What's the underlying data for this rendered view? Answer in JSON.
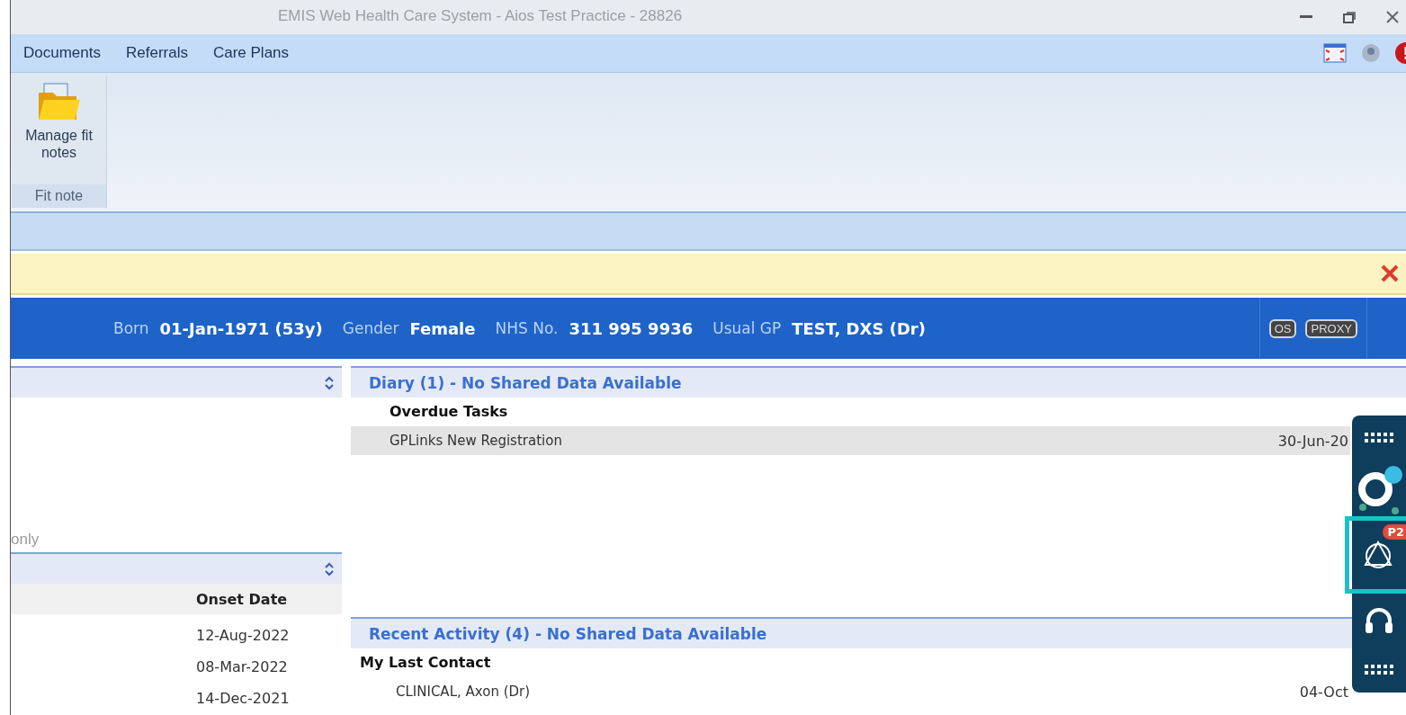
{
  "window": {
    "title": "EMIS Web Health Care System - Aios Test Practice - 28826"
  },
  "menu": [
    {
      "label": "Documents"
    },
    {
      "label": "Referrals"
    },
    {
      "label": "Care Plans"
    }
  ],
  "ribbon": {
    "groups": [
      {
        "label": "Fit note",
        "buttons": [
          {
            "label": "Manage fit notes"
          }
        ]
      }
    ]
  },
  "patient_banner": {
    "fields": [
      {
        "label": "Born",
        "value": "01-Jan-1971 (53y)"
      },
      {
        "label": "Gender",
        "value": "Female"
      },
      {
        "label": "NHS No.",
        "value": "311 995 9936"
      },
      {
        "label": "Usual GP",
        "value": "TEST, DXS (Dr)"
      }
    ],
    "badges": [
      "OS",
      "PROXY"
    ]
  },
  "left_panels": [
    {
      "note": "only"
    },
    {
      "columns": [
        "Onset Date"
      ],
      "rows": [
        "12-Aug-2022",
        "08-Mar-2022",
        "14-Dec-2021"
      ]
    }
  ],
  "diary": {
    "title": "Diary (1) - No Shared Data Available",
    "group": "Overdue Tasks",
    "items": [
      {
        "name": "GPLinks New Registration",
        "date": "30-Jun-20"
      }
    ]
  },
  "recent_activity": {
    "title": "Recent Activity (4) - No Shared Data Available",
    "group": "My Last Contact",
    "items": [
      {
        "name": "CLINICAL, Axon (Dr)",
        "date": "04-Oct"
      }
    ]
  },
  "side_toolbar": {
    "items": [
      {
        "kind": "grid",
        "selected": false
      },
      {
        "kind": "logo",
        "selected": false
      },
      {
        "kind": "agent",
        "selected": true,
        "badge": "P2"
      },
      {
        "kind": "headset",
        "selected": false
      },
      {
        "kind": "grid",
        "selected": false
      }
    ]
  }
}
